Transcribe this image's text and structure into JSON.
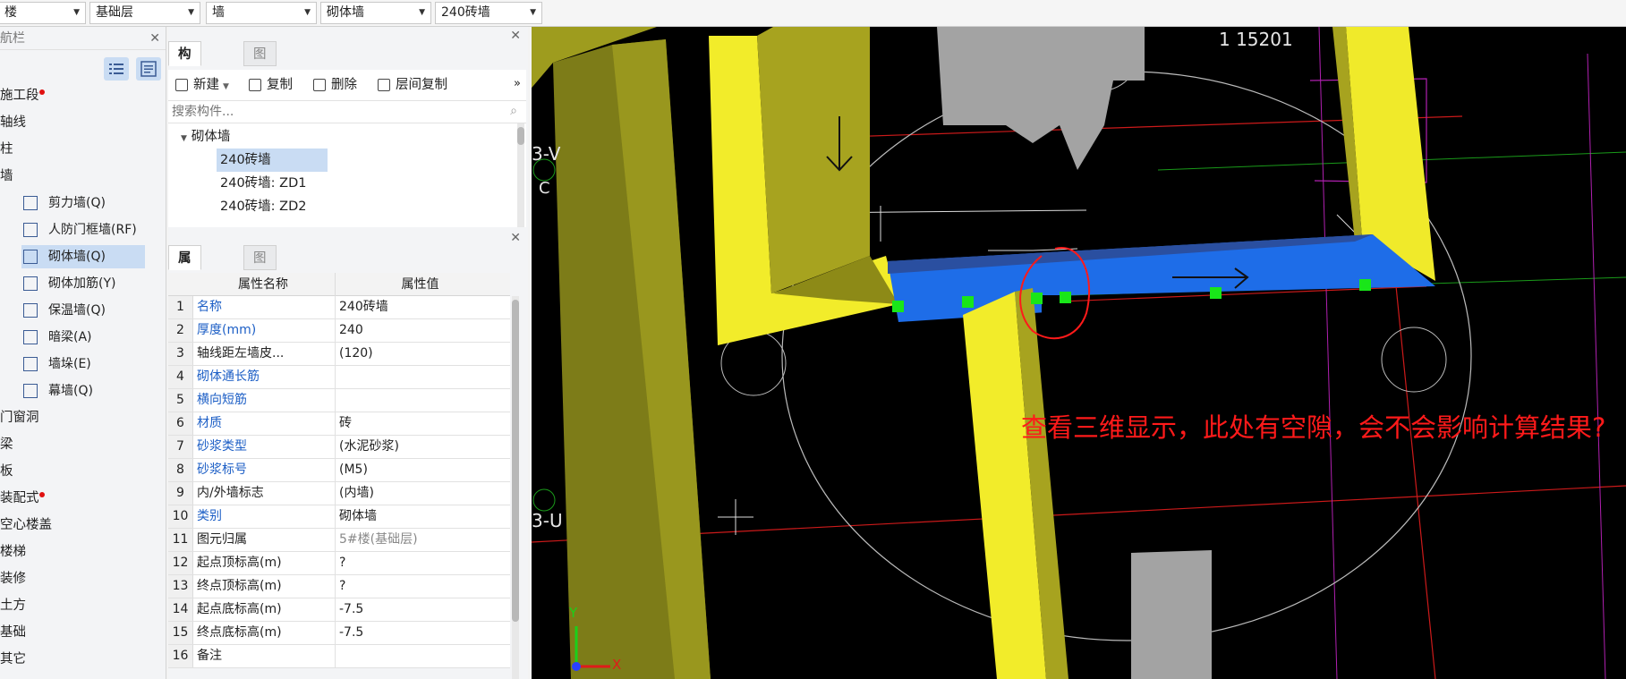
{
  "topbar": {
    "selectors": [
      "楼",
      "基础层",
      "墙",
      "砌体墙",
      "240砖墙"
    ]
  },
  "nav": {
    "title": "航栏",
    "items": [
      {
        "label": "施工段",
        "dot": true
      },
      {
        "label": "轴线"
      },
      {
        "label": "柱"
      },
      {
        "label": "墙"
      },
      {
        "label": "剪力墙(Q)",
        "sub": true
      },
      {
        "label": "人防门框墙(RF)",
        "sub": true
      },
      {
        "label": "砌体墙(Q)",
        "sub": true,
        "active": true
      },
      {
        "label": "砌体加筋(Y)",
        "sub": true
      },
      {
        "label": "保温墙(Q)",
        "sub": true
      },
      {
        "label": "暗梁(A)",
        "sub": true
      },
      {
        "label": "墙垛(E)",
        "sub": true
      },
      {
        "label": "幕墙(Q)",
        "sub": true
      },
      {
        "label": "门窗洞"
      },
      {
        "label": "梁"
      },
      {
        "label": "板"
      },
      {
        "label": "装配式",
        "dot": true
      },
      {
        "label": "空心楼盖"
      },
      {
        "label": "楼梯"
      },
      {
        "label": "装修"
      },
      {
        "label": "土方"
      },
      {
        "label": "基础"
      },
      {
        "label": "其它"
      }
    ]
  },
  "component_panel": {
    "tabs": [
      "构件列表",
      "图纸管理"
    ],
    "toolbar": {
      "new": "新建",
      "copy": "复制",
      "delete": "删除",
      "floor_copy": "层间复制"
    },
    "search_placeholder": "搜索构件...",
    "tree": {
      "group": "砌体墙",
      "items": [
        "240砖墙",
        "240砖墙: ZD1",
        "240砖墙: ZD2"
      ]
    }
  },
  "property_panel": {
    "tabs": [
      "属性列表",
      "图层管理"
    ],
    "headers": {
      "name": "属性名称",
      "value": "属性值"
    },
    "rows": [
      {
        "idx": "1",
        "name": "名称",
        "value": "240砖墙",
        "link": true
      },
      {
        "idx": "2",
        "name": "厚度(mm)",
        "value": "240",
        "link": true
      },
      {
        "idx": "3",
        "name": "轴线距左墙皮...",
        "value": "(120)"
      },
      {
        "idx": "4",
        "name": "砌体通长筋",
        "value": "",
        "link": true
      },
      {
        "idx": "5",
        "name": "横向短筋",
        "value": "",
        "link": true
      },
      {
        "idx": "6",
        "name": "材质",
        "value": "砖",
        "link": true
      },
      {
        "idx": "7",
        "name": "砂浆类型",
        "value": "(水泥砂浆)",
        "link": true
      },
      {
        "idx": "8",
        "name": "砂浆标号",
        "value": "(M5)",
        "link": true
      },
      {
        "idx": "9",
        "name": "内/外墙标志",
        "value": "(内墙)"
      },
      {
        "idx": "10",
        "name": "类别",
        "value": "砌体墙",
        "link": true
      },
      {
        "idx": "11",
        "name": "图元归属",
        "value": "5#楼(基础层)",
        "gray": true
      },
      {
        "idx": "12",
        "name": "起点顶标高(m)",
        "value": "?"
      },
      {
        "idx": "13",
        "name": "终点顶标高(m)",
        "value": "?"
      },
      {
        "idx": "14",
        "name": "起点底标高(m)",
        "value": "-7.5"
      },
      {
        "idx": "15",
        "name": "终点底标高(m)",
        "value": "-7.5"
      },
      {
        "idx": "16",
        "name": "备注",
        "value": ""
      }
    ]
  },
  "viewport": {
    "annotation": "查看三维显示，此处有空隙，会不会影响计算结果?",
    "labels": {
      "dim": "1 15201",
      "axis_v": "3-V",
      "axis_c": "C",
      "axis_u": "3-U",
      "x": "X",
      "y": "Y"
    }
  }
}
